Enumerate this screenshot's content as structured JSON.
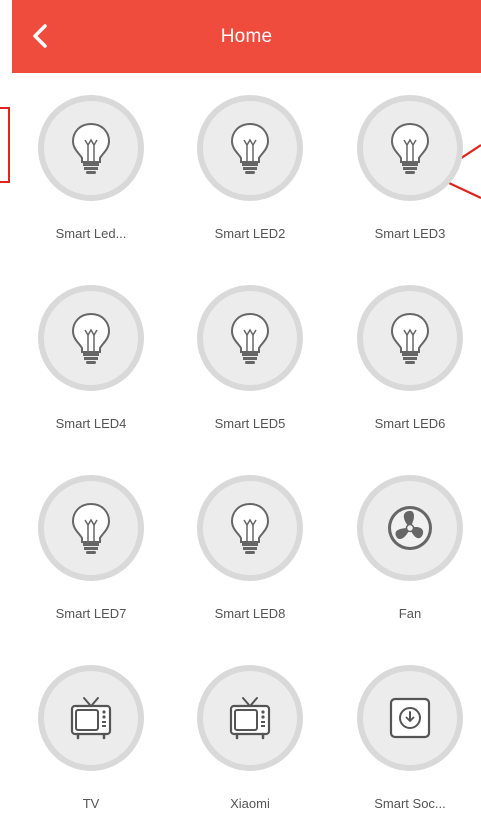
{
  "header": {
    "title": "Home",
    "back_icon": "chevron-left-icon"
  },
  "colors": {
    "accent": "#f04c3e",
    "annotation": "#e0231c"
  },
  "devices": [
    {
      "label": "Smart Led...",
      "icon": "lightbulb-icon"
    },
    {
      "label": "Smart LED2",
      "icon": "lightbulb-icon"
    },
    {
      "label": "Smart LED3",
      "icon": "lightbulb-icon"
    },
    {
      "label": "Smart LED4",
      "icon": "lightbulb-icon"
    },
    {
      "label": "Smart LED5",
      "icon": "lightbulb-icon"
    },
    {
      "label": "Smart LED6",
      "icon": "lightbulb-icon"
    },
    {
      "label": "Smart LED7",
      "icon": "lightbulb-icon"
    },
    {
      "label": "Smart LED8",
      "icon": "lightbulb-icon"
    },
    {
      "label": "Fan",
      "icon": "fan-icon"
    },
    {
      "label": "TV",
      "icon": "tv-icon"
    },
    {
      "label": "Xiaomi",
      "icon": "tv-icon"
    },
    {
      "label": "Smart Soc...",
      "icon": "socket-icon"
    }
  ]
}
